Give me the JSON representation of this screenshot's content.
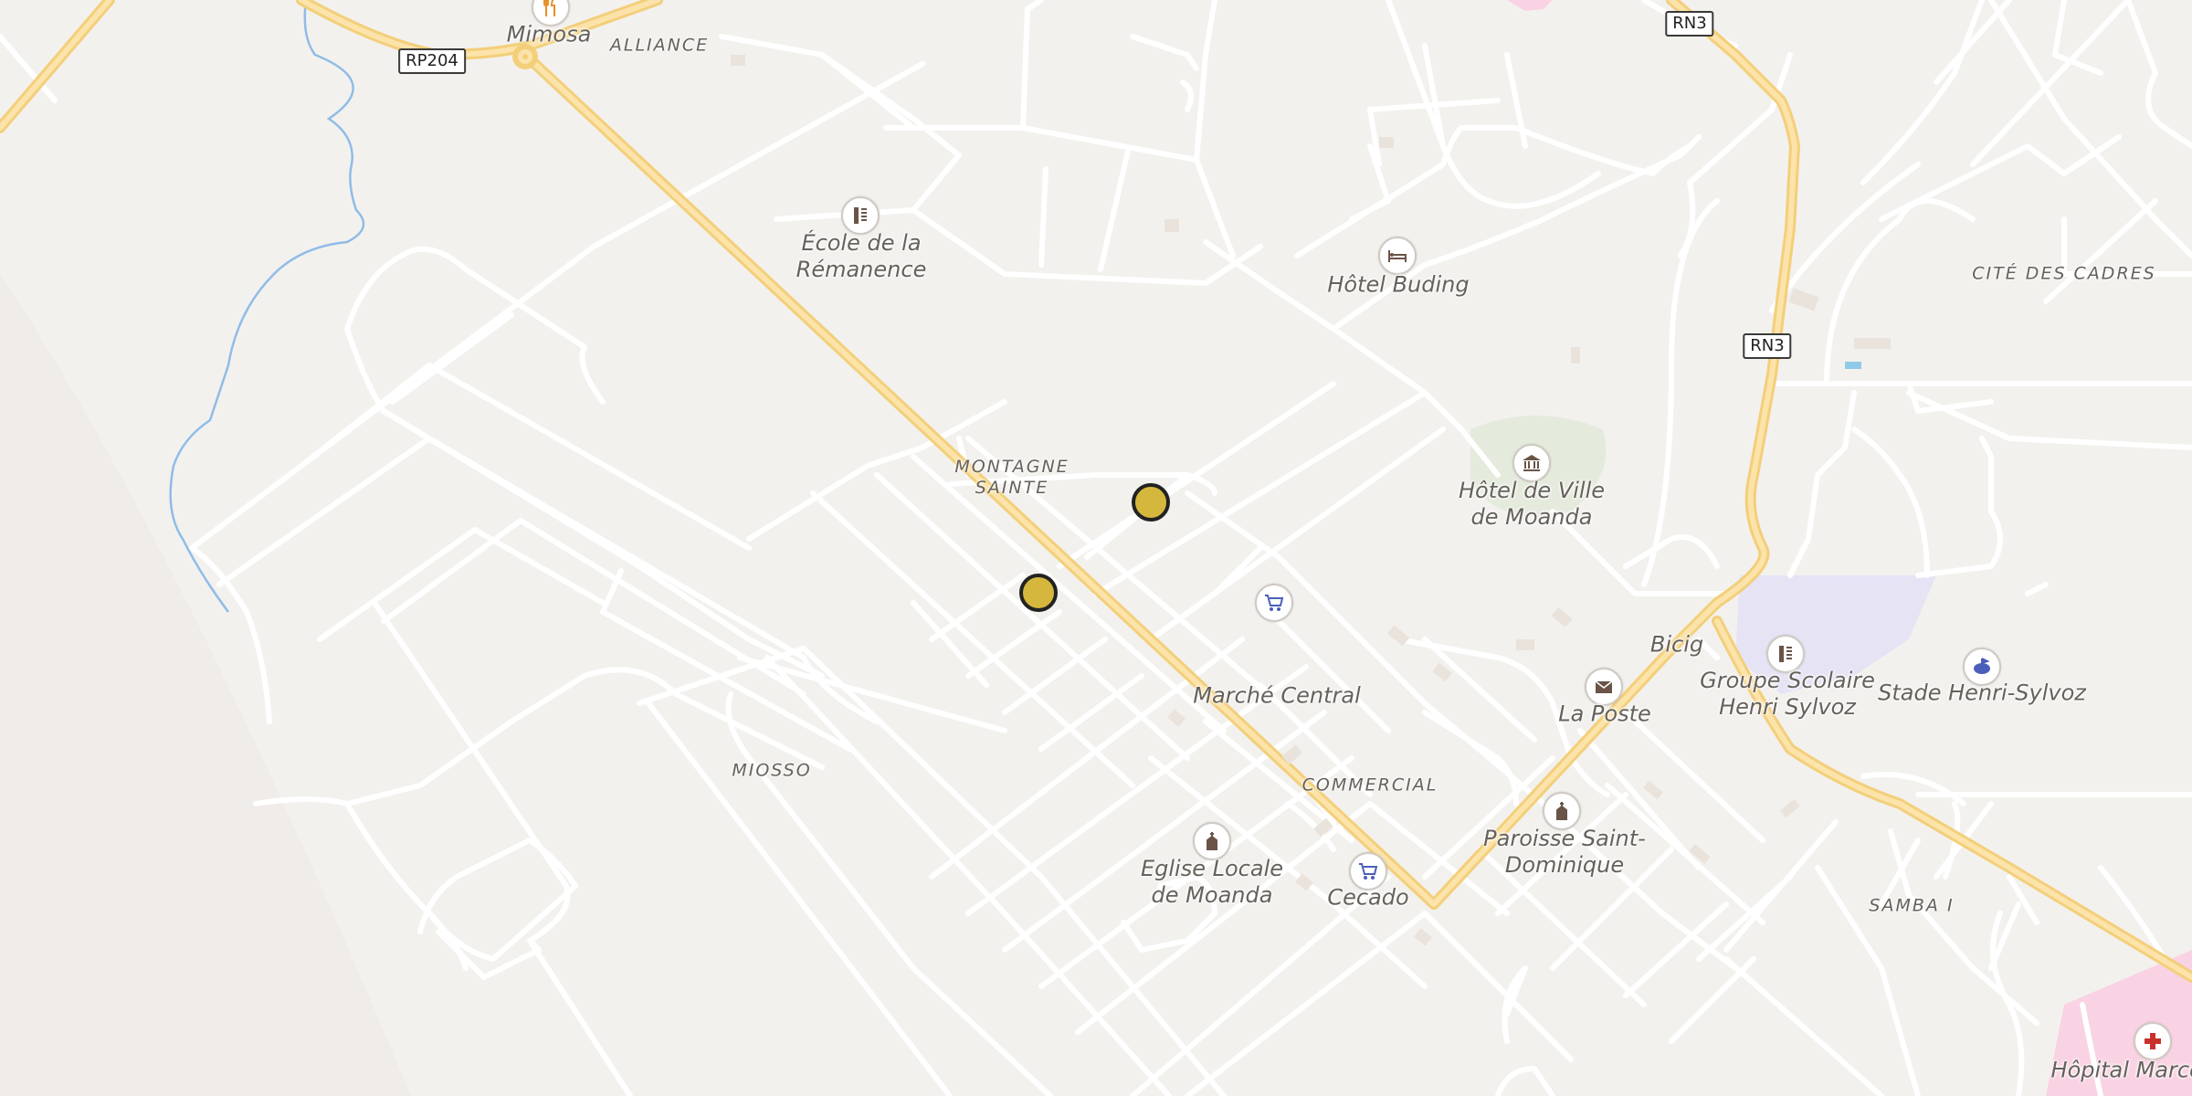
{
  "colors": {
    "background": "#f3f1ee",
    "street": "#ffffff",
    "primary_road": "#f7d58b",
    "water": "#8fbce8",
    "marker": "#d4b73c",
    "hospital": "#f9cde0",
    "school": "#e6e3f5",
    "park": "#e6ecdf"
  },
  "route_shields": [
    {
      "id": "rp204",
      "text": "RP204"
    },
    {
      "id": "rn3-top",
      "text": "RN3"
    },
    {
      "id": "rn3-mid",
      "text": "RN3"
    }
  ],
  "districts": {
    "alliance": "ALLIANCE",
    "montagne": "MONTAGNE\nSAINTE",
    "cite": "CITÉ DES CADRES",
    "miosso": "MIOSSO",
    "commercial": "COMMERCIAL",
    "samba": "SAMBA I"
  },
  "pois": {
    "mimosa": {
      "label": "Mimosa",
      "icon": "restaurant-icon"
    },
    "ecole": {
      "label": "École de la\nRémanence",
      "icon": "school-icon"
    },
    "hotel_buding": {
      "label": "Hôtel Buding",
      "icon": "hotel-icon"
    },
    "hotel_ville": {
      "label": "Hôtel de Ville\nde Moanda",
      "icon": "town-hall-icon"
    },
    "bicig": {
      "label": "Bicig",
      "icon": "bank-icon"
    },
    "groupe_scolaire": {
      "label": "Groupe Scolaire\nHenri Sylvoz",
      "icon": "school-icon"
    },
    "stade": {
      "label": "Stade Henri-Sylvoz",
      "icon": "stadium-icon"
    },
    "marche": {
      "label": "Marché Central",
      "icon": "cart-icon"
    },
    "la_poste": {
      "label": "La Poste",
      "icon": "mail-icon"
    },
    "paroisse": {
      "label": "Paroisse Saint-\nDominique",
      "icon": "church-icon"
    },
    "eglise": {
      "label": "Eglise Locale\nde Moanda",
      "icon": "church-icon"
    },
    "cecado": {
      "label": "Cecado",
      "icon": "cart-icon"
    },
    "hopital": {
      "label": "Hôpital Marcel",
      "icon": "hospital-icon"
    }
  },
  "markers": [
    {
      "id": "marker-1",
      "icon": "location-marker-icon"
    },
    {
      "id": "marker-2",
      "icon": "location-marker-icon"
    }
  ]
}
